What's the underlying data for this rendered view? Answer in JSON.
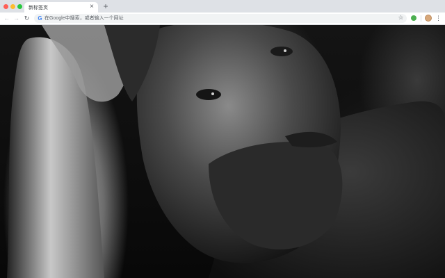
{
  "browser": {
    "tab": {
      "title": "新标签页",
      "close_glyph": "×"
    },
    "new_tab_glyph": "+",
    "toolbar": {
      "back_icon": "←",
      "forward_icon": "→",
      "reload_icon": "↻",
      "omnibox_icon": "G",
      "omnibox_placeholder": "在Google中搜索，或者输入一个网址",
      "bookmark_icon": "☆",
      "menu_icon": "⋮"
    }
  },
  "page": {
    "background_image": "black-and-white portrait photo of a bearded man resting his head on his hand"
  }
}
